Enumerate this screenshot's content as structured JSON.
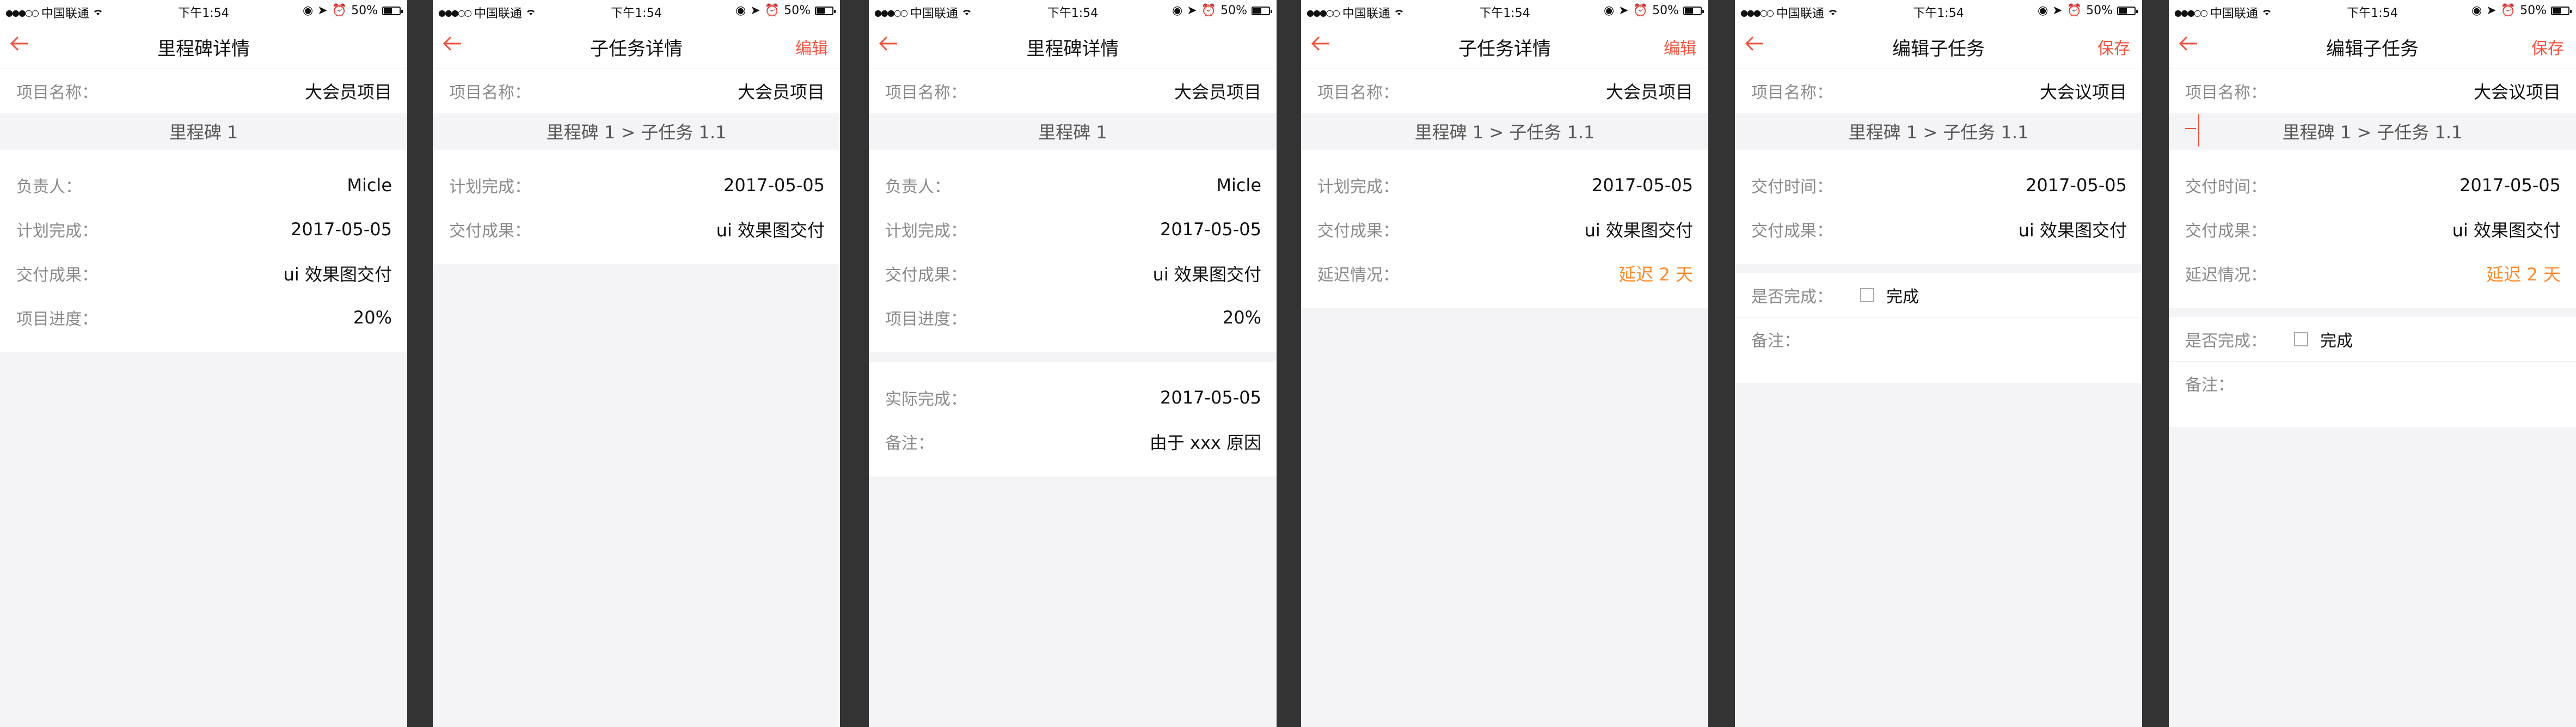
{
  "status": {
    "carrier": "中国联通",
    "signal_dots": "●●●○○",
    "wifi_icon": "wifi-icon",
    "time": "下午1:54",
    "battery": "50%",
    "battery_level": 0.5
  },
  "colors": {
    "accent": "#f0533f",
    "warning": "#fd8a2a",
    "background": "#f4f4f6",
    "divider": "#333333"
  },
  "screen1": {
    "title": "里程碑详情",
    "back_icon": "back-arrow-icon",
    "project_label": "项目名称：",
    "project_value": "大会员项目",
    "crumb": "里程碑 1",
    "owner_label": "负责人：",
    "owner_value": "Micle",
    "plan_label": "计划完成：",
    "plan_value": "2017-05-05",
    "deliver_label": "交付成果：",
    "deliver_value": "ui 效果图交付",
    "progress_label": "项目进度：",
    "progress_value": "20%"
  },
  "screen2": {
    "title": "子任务详情",
    "action": "编辑",
    "project_label": "项目名称：",
    "project_value": "大会员项目",
    "crumb": "里程碑 1 > 子任务 1.1",
    "plan_label": "计划完成：",
    "plan_value": "2017-05-05",
    "deliver_label": "交付成果：",
    "deliver_value": "ui 效果图交付"
  },
  "screen3": {
    "title": "里程碑详情",
    "project_label": "项目名称：",
    "project_value": "大会员项目",
    "crumb": "里程碑 1",
    "owner_label": "负责人：",
    "owner_value": "Micle",
    "plan_label": "计划完成：",
    "plan_value": "2017-05-05",
    "deliver_label": "交付成果：",
    "deliver_value": "ui 效果图交付",
    "progress_label": "项目进度：",
    "progress_value": "20%",
    "actual_label": "实际完成：",
    "actual_value": "2017-05-05",
    "note_label": "备注：",
    "note_value": "由于 xxx 原因"
  },
  "screen4": {
    "title": "子任务详情",
    "action": "编辑",
    "project_label": "项目名称：",
    "project_value": "大会员项目",
    "crumb": "里程碑 1 > 子任务 1.1",
    "plan_label": "计划完成：",
    "plan_value": "2017-05-05",
    "deliver_label": "交付成果：",
    "deliver_value": "ui 效果图交付",
    "delay_label": "延迟情况：",
    "delay_value": "延迟 2 天"
  },
  "screen5": {
    "title": "编辑子任务",
    "action": "保存",
    "project_label": "项目名称：",
    "project_value": "大会议项目",
    "crumb": "里程碑 1 > 子任务 1.1",
    "delivery_time_label": "交付时间：",
    "delivery_time_value": "2017-05-05",
    "deliver_label": "交付成果：",
    "deliver_value": "ui 效果图交付",
    "done_label": "是否完成：",
    "done_text": "完成",
    "note_label": "备注："
  },
  "screen6": {
    "title": "编辑子任务",
    "action": "保存",
    "project_label": "项目名称：",
    "project_value": "大会议项目",
    "crumb": "里程碑 1 > 子任务 1.1",
    "delivery_time_label": "交付时间：",
    "delivery_time_value": "2017-05-05",
    "deliver_label": "交付成果：",
    "deliver_value": "ui 效果图交付",
    "delay_label": "延迟情况：",
    "delay_value": "延迟 2 天",
    "done_label": "是否完成：",
    "done_text": "完成",
    "note_label": "备注："
  }
}
